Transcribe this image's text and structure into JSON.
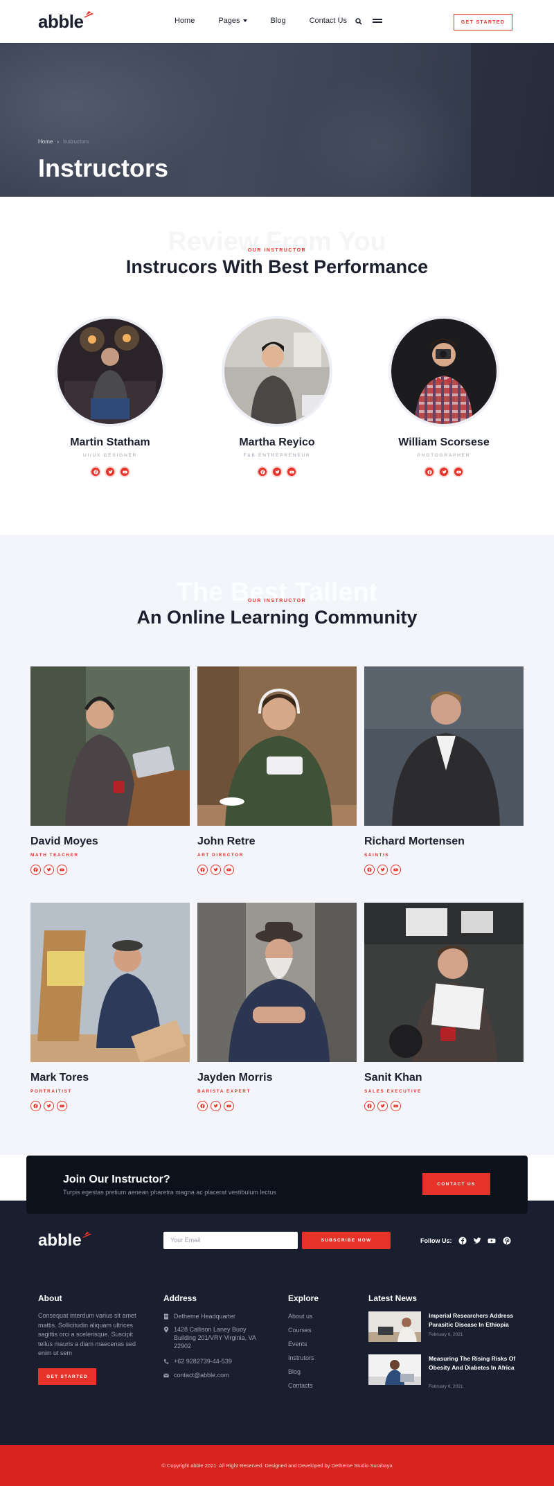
{
  "header": {
    "logo": "abble",
    "nav": [
      {
        "label": "Home"
      },
      {
        "label": "Pages",
        "dropdown": true
      },
      {
        "label": "Blog"
      },
      {
        "label": "Contact Us"
      }
    ],
    "cta": "GET STARTED",
    "icons": [
      "search-icon",
      "menu-icon"
    ]
  },
  "hero": {
    "breadcrumb": {
      "home": "Home",
      "current": "Instructors"
    },
    "title": "Instructors"
  },
  "section1": {
    "ghost": "Review From You",
    "kicker": "OUR INSTRUCTOR",
    "title": "Instrucors With Best Performance",
    "instructors": [
      {
        "name": "Martin Statham",
        "role": "UI/UX DESIGNER"
      },
      {
        "name": "Martha Reyico",
        "role": "F&B ENTREPRENEUR"
      },
      {
        "name": "William Scorsese",
        "role": "PHOTOGRAPHER"
      }
    ]
  },
  "section2": {
    "ghost": "The Best Tallent",
    "kicker": "OUR INSTRUCTOR",
    "title": "An Online Learning Community",
    "instructors": [
      {
        "name": "David Moyes",
        "role": "MATH TEACHER"
      },
      {
        "name": "John Retre",
        "role": "ART DIRECTOR"
      },
      {
        "name": "Richard Mortensen",
        "role": "SAINTIS"
      },
      {
        "name": "Mark Tores",
        "role": "PORTRAITIST"
      },
      {
        "name": "Jayden Morris",
        "role": "BARISTA EXPERT"
      },
      {
        "name": "Sanit Khan",
        "role": "SALES EXECUTIVE"
      }
    ]
  },
  "join": {
    "title": "Join Our Instructor?",
    "subtitle": "Turpis egestas pretium aenean pharetra magna ac placerat vestibulum lectus",
    "button": "CONTACT US"
  },
  "footer": {
    "logo": "abble",
    "email_placeholder": "Your Email",
    "subscribe": "SUBSCRIBE NOW",
    "follow_label": "Follow Us:",
    "about": {
      "heading": "About",
      "text": "Consequat interdum varius sit amet mattis. Sollicitudin aliquam ultrices sagittis orci a scelerisque. Suscipit tellus mauris a diam maecenas sed enim ut sem",
      "button": "GET STARTED"
    },
    "address": {
      "heading": "Address",
      "hq": "Detheme Headquarter",
      "street": "1428 Callison Laney Buoy Building 201/VRY Virginia, VA 22902",
      "phone": "+62 9282739-44-539",
      "email": "contact@abble.com"
    },
    "explore": {
      "heading": "Explore",
      "links": [
        "About us",
        "Courses",
        "Events",
        "Instrutors",
        "Blog",
        "Contacts"
      ]
    },
    "news": {
      "heading": "Latest News",
      "items": [
        {
          "title": "Imperial Researchers Address Parasitic Disease In Ethiopia",
          "date": "February 6, 2021"
        },
        {
          "title": "Measuring The Rising Risks Of Obesity And Diabetes In Africa",
          "date": "February 6, 2021"
        }
      ]
    },
    "copyright": "© Copyright abble 2021. All Right Reserved. Designed and Developed by Detheme Studio Surabaya"
  },
  "colors": {
    "accent": "#e5332a",
    "dark": "#1b1f2e",
    "footer": "#1a1f30",
    "banner": "#0d111c",
    "section_bg": "#f3f5fa"
  }
}
